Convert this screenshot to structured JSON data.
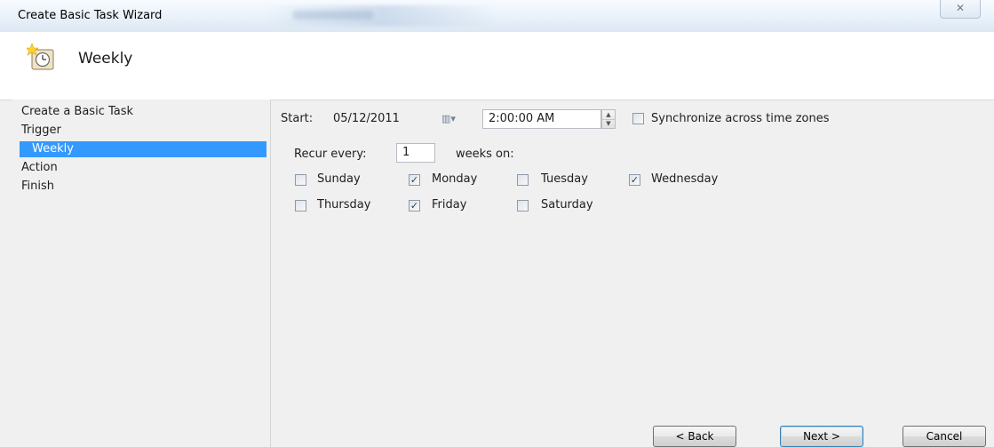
{
  "window": {
    "title": "Create Basic Task Wizard",
    "close_glyph": "✕"
  },
  "header": {
    "title": "Weekly",
    "icon": "clock-icon"
  },
  "sidebar": {
    "items": [
      {
        "label": "Create a Basic Task"
      },
      {
        "label": "Trigger"
      },
      {
        "label": "Weekly",
        "selected": true
      },
      {
        "label": "Action"
      },
      {
        "label": "Finish"
      }
    ]
  },
  "trigger": {
    "start_label": "Start:",
    "start_date": "05/12/2011",
    "calendar_glyph": "▥▾",
    "start_time": "2:00:00 AM",
    "sync_label": "Synchronize across time zones",
    "sync_checked": false,
    "recur_label": "Recur every:",
    "recur_value": "1",
    "weeks_on_label": "weeks on:",
    "days": [
      {
        "label": "Sunday",
        "checked": false
      },
      {
        "label": "Monday",
        "checked": true
      },
      {
        "label": "Tuesday",
        "checked": false
      },
      {
        "label": "Wednesday",
        "checked": true
      },
      {
        "label": "Thursday",
        "checked": false
      },
      {
        "label": "Friday",
        "checked": true
      },
      {
        "label": "Saturday",
        "checked": false
      }
    ]
  },
  "buttons": {
    "back": "< Back",
    "next": "Next >",
    "cancel": "Cancel"
  },
  "colors": {
    "selection": "#3399ff"
  }
}
